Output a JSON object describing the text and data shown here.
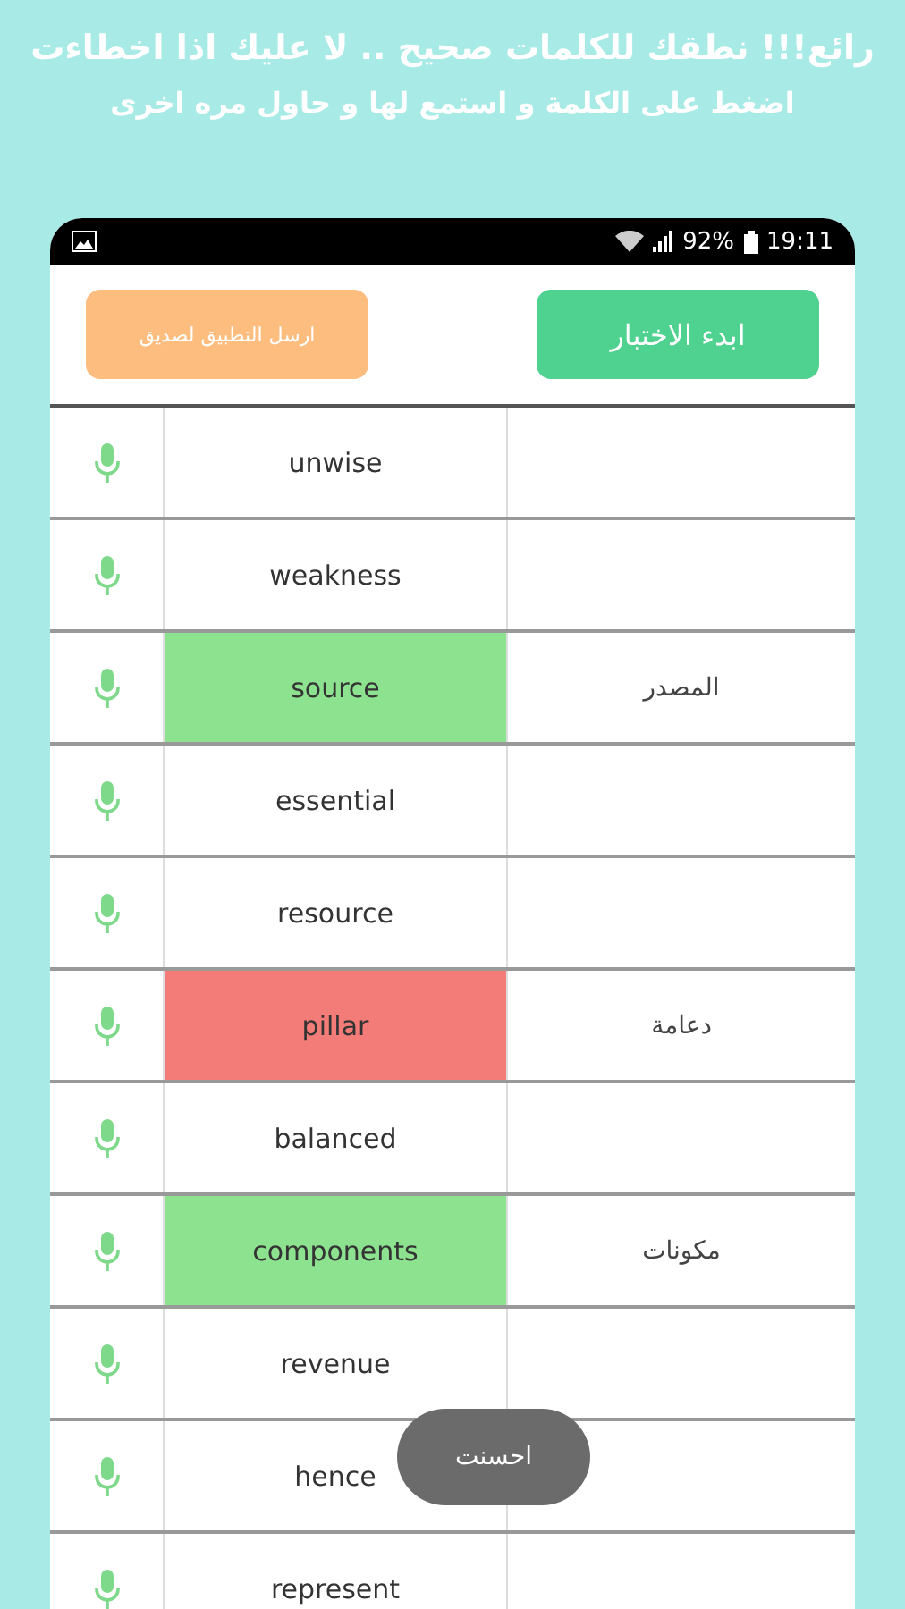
{
  "headline": "رائع!!! نطقك للكلمات صحيح .. لا عليك اذا اخطاءت",
  "subheadline": "اضغط على الكلمة و استمع لها و حاول مره اخرى",
  "status_bar": {
    "battery": "92%",
    "time": "19:11"
  },
  "buttons": [
    {
      "label": "ابدء الاختبار",
      "kind": "start"
    },
    {
      "label": "ارسل التطبيق لصديق",
      "kind": "share"
    }
  ],
  "words": [
    {
      "word": "unwise",
      "kind": "plain"
    },
    {
      "word": "weakness",
      "kind": "plain"
    },
    {
      "word": "source",
      "translation": "المصدر",
      "kind": "correct"
    },
    {
      "word": "essential",
      "kind": "plain"
    },
    {
      "word": "resource",
      "kind": "plain"
    },
    {
      "word": "pillar",
      "translation": "دعامة",
      "kind": "wrong"
    },
    {
      "word": "balanced",
      "kind": "plain"
    },
    {
      "word": "components",
      "translation": "مكونات",
      "kind": "correct"
    },
    {
      "word": "revenue",
      "kind": "plain"
    },
    {
      "word": "hence",
      "kind": "plain"
    },
    {
      "word": "represent",
      "kind": "plain"
    }
  ],
  "toast": "احسنت"
}
